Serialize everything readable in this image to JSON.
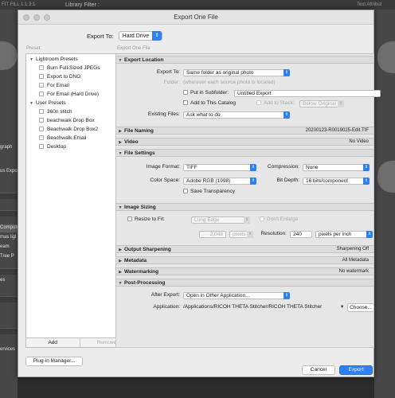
{
  "background": {
    "menu_left": "FIT  FILL  1:1  3:1",
    "library_filter": "Library Filter :",
    "menu_right": "Text  Attribut",
    "left_labels": [
      "graph",
      "us Expo",
      "Compute",
      "mas ligl",
      "eam",
      "Tree P",
      "es",
      "ervices"
    ]
  },
  "dialog": {
    "title": "Export One File",
    "export_to_label": "Export To:",
    "export_to_value": "Hard Drive",
    "presets_label": "Preset:",
    "export_file_label": "Export One File"
  },
  "presets": {
    "groups": [
      {
        "name": "Lightroom Presets",
        "items": [
          "Burn Full-Sized JPEGs",
          "Export to DNG",
          "For Email",
          "For Email (Hard Drive)"
        ]
      },
      {
        "name": "User Presets",
        "items": [
          "360n stitch",
          "beachwalk Drop Box",
          "Beachwalk Drop Box2",
          "Beachwalk Email",
          "Desktop"
        ]
      }
    ],
    "add_label": "Add",
    "remove_label": "Remove"
  },
  "export_location": {
    "header": "Export Location",
    "export_to_label": "Export To:",
    "export_to_value": "Same folder as original photo",
    "folder_label": "Folder:",
    "folder_value": "(wherever each source photo is located)",
    "subfolder_label": "Put in Subfolder:",
    "subfolder_value": "Untitled Export",
    "add_catalog_label": "Add to This Catalog",
    "add_stack_label": "Add to Stack:",
    "stack_position": "Below Original",
    "existing_label": "Existing Files:",
    "existing_value": "Ask what to do"
  },
  "file_naming": {
    "header": "File Naming",
    "summary": "20200123-R0019025-Edit.TIF"
  },
  "video": {
    "header": "Video",
    "summary": "No Video"
  },
  "file_settings": {
    "header": "File Settings",
    "format_label": "Image Format:",
    "format_value": "TIFF",
    "compression_label": "Compression:",
    "compression_value": "None",
    "colorspace_label": "Color Space:",
    "colorspace_value": "Adobe RGB (1998)",
    "bitdepth_label": "Bit Depth:",
    "bitdepth_value": "16 bits/component",
    "transparency_label": "Save Transparency"
  },
  "image_sizing": {
    "header": "Image Sizing",
    "resize_label": "Resize to Fit:",
    "resize_value": "Long Edge",
    "dont_enlarge_label": "Don't Enlarge",
    "size_value": "2,048",
    "size_unit": "pixels",
    "resolution_label": "Resolution:",
    "resolution_value": "240",
    "resolution_unit": "pixels per inch"
  },
  "output_sharpening": {
    "header": "Output Sharpening",
    "summary": "Sharpening Off"
  },
  "metadata": {
    "header": "Metadata",
    "summary": "All Metadata"
  },
  "watermarking": {
    "header": "Watermarking",
    "summary": "No watermark"
  },
  "post_processing": {
    "header": "Post-Processing",
    "after_export_label": "After Export:",
    "after_export_value": "Open in Other Application...",
    "application_label": "Application:",
    "application_value": "/Applications/RICOH THETA Stitcher/RICOH THETA Stitcher",
    "choose_label": "Choose..."
  },
  "footer": {
    "plugin_manager": "Plug-in Manager...",
    "cancel": "Cancel",
    "export": "Export"
  }
}
